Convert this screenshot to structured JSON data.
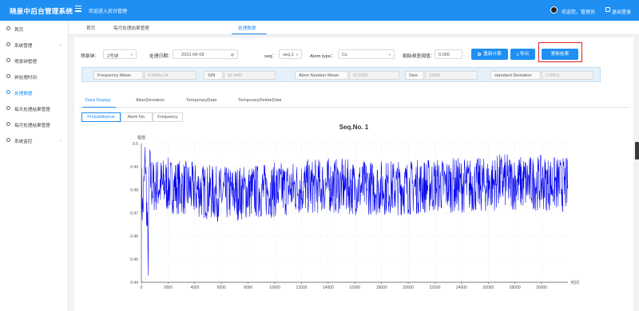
{
  "header": {
    "brand": "晓泉中后台管理系统",
    "welcome": "欢迎进入后台管理",
    "user_greeting": "欢迎您，管理员",
    "logout_label": "退出登录",
    "accent": "#1f8ff3"
  },
  "sidebar": {
    "items": [
      {
        "label": "首页",
        "icon": "home-icon"
      },
      {
        "label": "系统管理",
        "icon": "gear-icon"
      },
      {
        "label": "喷泉钟管理",
        "icon": "clock-icon"
      },
      {
        "label": "钟处理时间",
        "icon": "clock-icon"
      },
      {
        "label": "处理数据",
        "icon": "clock-icon",
        "active": true
      },
      {
        "label": "每天处理结果管理",
        "icon": "clock-icon"
      },
      {
        "label": "每月处理结果管理",
        "icon": "clock-icon"
      },
      {
        "label": "系统监控",
        "icon": "monitor-icon"
      }
    ]
  },
  "tabs": [
    {
      "label": "首页"
    },
    {
      "label": "每月处理结果管理"
    },
    {
      "label": "处理数据",
      "active": true
    }
  ],
  "filters": {
    "clock_label": "喷泉钟：",
    "clock_value": "2号钟",
    "date_label": "处理日期：",
    "date_value": "2021-06-09",
    "seq_label": "seq：",
    "seq_value": "seq.1",
    "atom_label": "Atom type：",
    "atom_value": "Cs",
    "threshold_label": "剔除频差阈值：",
    "threshold_value": "0.005"
  },
  "buttons": {
    "recalc": "重新计算",
    "export": "导出",
    "update": "更新结果"
  },
  "stats": [
    {
      "label": "Frequency Mean",
      "value": "4.4409e-14"
    },
    {
      "label": "S/N",
      "value": "82.9445"
    },
    {
      "label": "Atom Number Mean",
      "value": "22.6509"
    },
    {
      "label": "Size",
      "value": "31969"
    },
    {
      "label": "standard Deviation",
      "value": "0.00511"
    }
  ],
  "data_tabs": [
    {
      "label": "Data Display",
      "active": true
    },
    {
      "label": "AllanDeviation"
    },
    {
      "label": "TemporaryData"
    },
    {
      "label": "TemporaryDeleteData"
    }
  ],
  "view_options": [
    {
      "label": "Probabilitytrue",
      "active": true
    },
    {
      "label": "Atom No."
    },
    {
      "label": "Frequency"
    }
  ],
  "chart_data": {
    "type": "line",
    "title": "Seq.No. 1",
    "ylabel": "幅值",
    "xlabel": "时间",
    "xlim": [
      0,
      31969
    ],
    "ylim": [
      0.44,
      0.5
    ],
    "xticks": [
      0,
      2000,
      4000,
      6000,
      8000,
      10000,
      12000,
      14000,
      16000,
      18000,
      20000,
      22000,
      24000,
      26000,
      28000,
      30000
    ],
    "yticks": [
      0.44,
      0.45,
      0.46,
      0.47,
      0.48,
      0.49,
      0.5
    ],
    "series": [
      {
        "color": "#0000ee",
        "x": [
          0,
          100,
          300,
          500,
          600,
          800,
          1000,
          2000,
          4000,
          6000,
          8000,
          10000,
          12000,
          14000,
          16000,
          18000,
          20000,
          22000,
          24000,
          26000,
          27000,
          28000,
          30000,
          31969
        ],
        "y": [
          0.482,
          0.47,
          0.494,
          0.451,
          0.489,
          0.481,
          0.482,
          0.482,
          0.48,
          0.478,
          0.479,
          0.48,
          0.481,
          0.482,
          0.481,
          0.481,
          0.481,
          0.482,
          0.482,
          0.482,
          0.484,
          0.483,
          0.483,
          0.482
        ],
        "noise_band": 0.012
      }
    ]
  }
}
